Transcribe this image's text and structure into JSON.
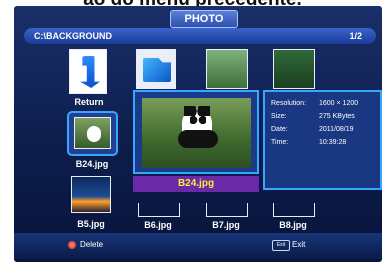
{
  "cut_text": "ão do menu precedente.",
  "header": {
    "tab": "PHOTO"
  },
  "pathbar": {
    "path": "C:\\BACKGROUND",
    "page": "1/2"
  },
  "thumbnails": {
    "row1": [
      "Return",
      "",
      "",
      ""
    ],
    "row2": [
      "B24.jpg"
    ],
    "row3": [
      "B5.jpg",
      "B6.jpg",
      "B7.jpg",
      "B8.jpg"
    ]
  },
  "selected": {
    "filename": "B24.jpg"
  },
  "info": {
    "resolution_label": "Resolution:",
    "resolution": "1600 × 1200",
    "size_label": "Size:",
    "size": "275 KBytes",
    "date_label": "Date:",
    "date": "2011/08/19",
    "time_label": "Time:",
    "time": "10:39:28"
  },
  "footer": {
    "delete": "Delete",
    "exit_key": "Exit",
    "exit": "Exit"
  },
  "colors": {
    "accent": "#37a6ff",
    "bg": "#0d1d4b",
    "selection": "#6a2aa8",
    "delete_dot": "#d0211d"
  },
  "icons": [
    "return-arrow-icon",
    "folder-icon",
    "image-thumbnail-icon",
    "red-button-icon",
    "exit-key-icon"
  ]
}
